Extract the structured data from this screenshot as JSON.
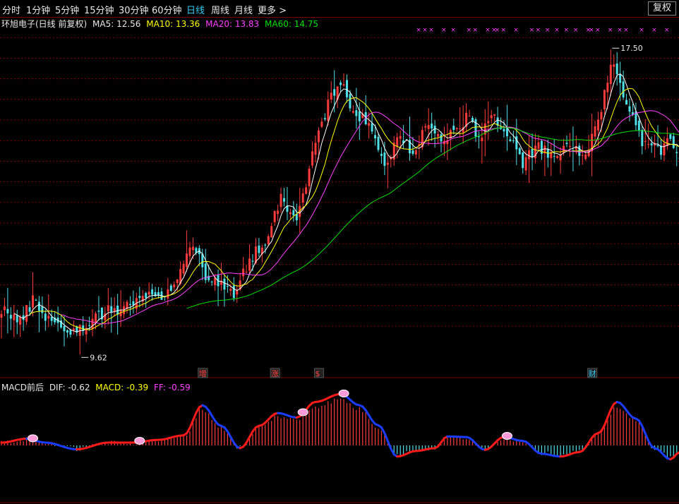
{
  "toolbar": {
    "tabs": [
      {
        "label": "分时"
      },
      {
        "label": "1分钟"
      },
      {
        "label": "5分钟"
      },
      {
        "label": "15分钟"
      },
      {
        "label": "30分钟"
      },
      {
        "label": "60分钟"
      },
      {
        "label": "日线"
      },
      {
        "label": "周线"
      },
      {
        "label": "月线"
      }
    ],
    "more_label": "更多",
    "more_arrow": ">",
    "fq_label": "复权"
  },
  "legend": {
    "title": "环旭电子(日线 前复权)",
    "ma5": "MA5: 12.56",
    "ma10": "MA10: 13.36",
    "ma20": "MA20: 13.83",
    "ma60": "MA60: 14.75"
  },
  "macd_legend": {
    "title": "MACD前后",
    "dif": "DIF: -0.62",
    "macd": "MACD: -0.39",
    "ff": "FF: -0.59"
  },
  "colors": {
    "up": "#ff3b3b",
    "down": "#4ee0e8",
    "ma5": "#ffffff",
    "ma10": "#ffff00",
    "ma20": "#ff40ff",
    "ma60": "#00e000",
    "grid": "#7a0000",
    "tab_active": "#35c8f0"
  },
  "chart_data": [
    {
      "type": "candlestick",
      "price_range": [
        9.0,
        18.1
      ],
      "markers": {
        "high": {
          "label": "17.50",
          "value": 17.5
        },
        "low": {
          "label": "9.62",
          "value": 9.62
        }
      },
      "events": [
        {
          "label": "增",
          "color": "#ff4040"
        },
        {
          "label": "涨",
          "color": "#ff4040"
        },
        {
          "label": "$",
          "color": "#ff4040"
        },
        {
          "label": "财",
          "color": "#35c8f0"
        }
      ],
      "x_marker": "×",
      "anchors": [
        [
          0,
          10.6
        ],
        [
          6,
          10.2
        ],
        [
          10,
          10.8
        ],
        [
          15,
          10.3
        ],
        [
          19,
          10.1
        ],
        [
          24,
          9.9
        ],
        [
          30,
          10.4
        ],
        [
          38,
          10.6
        ],
        [
          43,
          10.8
        ],
        [
          49,
          10.9
        ],
        [
          53,
          11.0
        ],
        [
          58,
          11.7
        ],
        [
          61,
          12.4
        ],
        [
          65,
          11.5
        ],
        [
          68,
          11.3
        ],
        [
          71,
          11.1
        ],
        [
          74,
          10.9
        ],
        [
          79,
          11.9
        ],
        [
          84,
          12.4
        ],
        [
          89,
          13.6
        ],
        [
          94,
          12.9
        ],
        [
          99,
          14.7
        ],
        [
          104,
          16.1
        ],
        [
          108,
          16.6
        ],
        [
          113,
          15.8
        ],
        [
          118,
          15.4
        ],
        [
          122,
          14.3
        ],
        [
          126,
          15.2
        ],
        [
          131,
          14.8
        ],
        [
          136,
          15.6
        ],
        [
          140,
          15.0
        ],
        [
          144,
          15.3
        ],
        [
          148,
          15.7
        ],
        [
          152,
          15.2
        ],
        [
          157,
          15.8
        ],
        [
          161,
          15.2
        ],
        [
          166,
          14.5
        ],
        [
          171,
          14.9
        ],
        [
          176,
          14.6
        ],
        [
          181,
          15.0
        ],
        [
          186,
          14.6
        ],
        [
          190,
          15.6
        ],
        [
          195,
          17.3
        ],
        [
          199,
          16.1
        ],
        [
          204,
          15.1
        ],
        [
          207,
          14.9
        ],
        [
          210,
          14.8
        ],
        [
          213,
          15.2
        ],
        [
          216,
          14.7
        ]
      ],
      "ma_periods": [
        5,
        10,
        20,
        60
      ]
    },
    {
      "type": "macd",
      "range": [
        -0.95,
        1.0
      ],
      "dif": [
        [
          0,
          0.05
        ],
        [
          8,
          0.12
        ],
        [
          14,
          0.05
        ],
        [
          24,
          -0.07
        ],
        [
          34,
          0.05
        ],
        [
          42,
          0.05
        ],
        [
          50,
          0.1
        ],
        [
          58,
          0.18
        ],
        [
          64,
          0.72
        ],
        [
          70,
          0.35
        ],
        [
          76,
          -0.05
        ],
        [
          82,
          0.35
        ],
        [
          88,
          0.58
        ],
        [
          94,
          0.5
        ],
        [
          100,
          0.78
        ],
        [
          108,
          0.92
        ],
        [
          114,
          0.72
        ],
        [
          120,
          0.36
        ],
        [
          126,
          -0.2
        ],
        [
          132,
          -0.1
        ],
        [
          138,
          -0.05
        ],
        [
          142,
          0.16
        ],
        [
          148,
          0.15
        ],
        [
          154,
          -0.08
        ],
        [
          160,
          0.15
        ],
        [
          166,
          0.08
        ],
        [
          172,
          -0.15
        ],
        [
          178,
          -0.2
        ],
        [
          184,
          -0.12
        ],
        [
          190,
          0.22
        ],
        [
          196,
          0.78
        ],
        [
          202,
          0.48
        ],
        [
          208,
          -0.05
        ],
        [
          213,
          -0.25
        ],
        [
          216,
          -0.12
        ]
      ]
    }
  ]
}
